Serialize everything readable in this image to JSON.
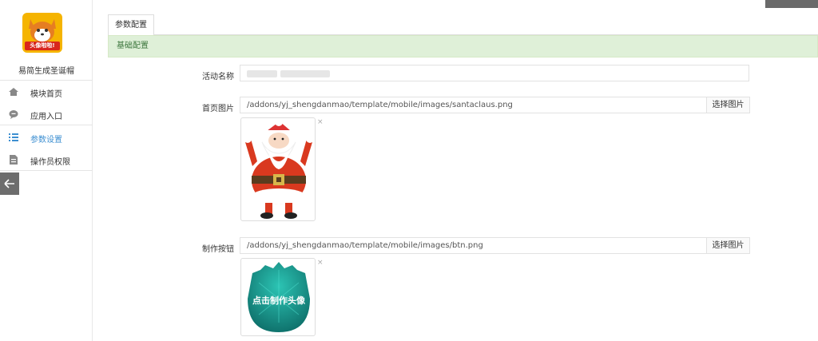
{
  "sidebar": {
    "app_name": "易简生成圣诞帽",
    "logo_text": "头像啦啦!",
    "items": [
      {
        "label": "模块首页",
        "icon": "home-icon"
      },
      {
        "label": "应用入口",
        "icon": "chat-bubble-icon"
      },
      {
        "label": "参数设置",
        "icon": "list-icon",
        "active": true
      },
      {
        "label": "操作员权限",
        "icon": "document-icon"
      }
    ]
  },
  "tabs": [
    {
      "label": "参数配置"
    }
  ],
  "panel": {
    "title": "基础配置"
  },
  "form": {
    "activity_name": {
      "label": "活动名称",
      "value": ""
    },
    "home_image": {
      "label": "首页图片",
      "value": "/addons/yj_shengdanmao/template/mobile/images/santaclaus.png",
      "button": "选择图片",
      "remove": "×"
    },
    "make_button": {
      "label": "制作按钮",
      "value": "/addons/yj_shengdanmao/template/mobile/images/btn.png",
      "button": "选择图片",
      "remove": "×",
      "image_text": "点击制作头像"
    }
  },
  "colors": {
    "accent": "#3d8fd1",
    "panel_bg": "#dff0d8",
    "panel_text": "#3c763d"
  }
}
